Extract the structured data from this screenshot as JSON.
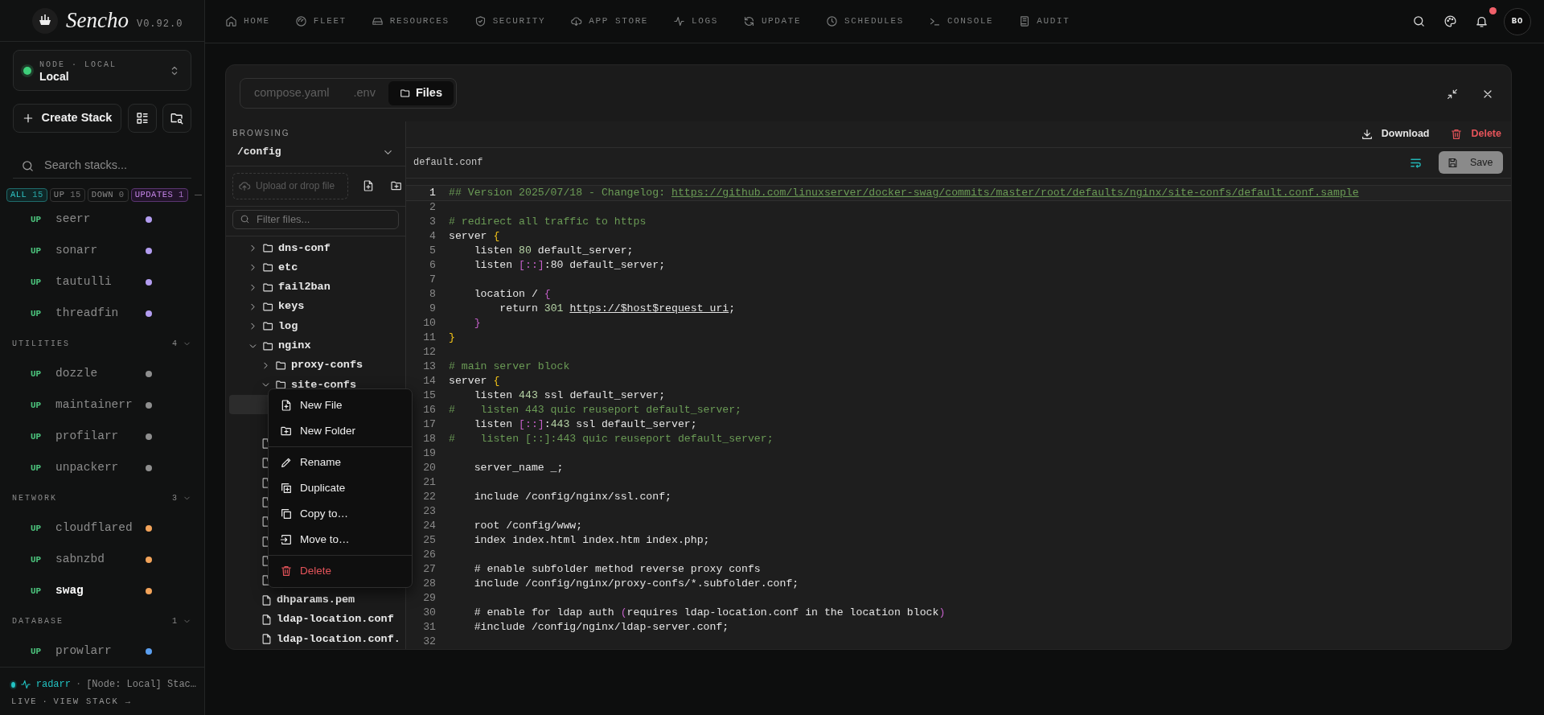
{
  "app": {
    "name": "Sencho",
    "version": "V0.92.0"
  },
  "node_selector": {
    "label": "NODE · LOCAL",
    "value": "Local"
  },
  "create_button": "Create Stack",
  "search": {
    "placeholder": "Search stacks..."
  },
  "filters": [
    {
      "label": "ALL",
      "count": "15",
      "selected": true,
      "kind": "status"
    },
    {
      "label": "UP",
      "count": "15",
      "selected": false,
      "kind": "status"
    },
    {
      "label": "DOWN",
      "count": "0",
      "selected": false,
      "kind": "status"
    },
    {
      "label": "UPDATES",
      "count": "1",
      "selected": false,
      "kind": "updates"
    }
  ],
  "stack_groups": [
    {
      "items": [
        {
          "status": "UP",
          "name": "seerr",
          "color": "#b39df0",
          "selected": false
        },
        {
          "status": "UP",
          "name": "sonarr",
          "color": "#b39df0",
          "selected": false
        },
        {
          "status": "UP",
          "name": "tautulli",
          "color": "#b39df0",
          "selected": false
        },
        {
          "status": "UP",
          "name": "threadfin",
          "color": "#b39df0",
          "selected": false
        }
      ]
    },
    {
      "title": "UTILITIES",
      "count": "4",
      "expanded": true,
      "items": [
        {
          "status": "UP",
          "name": "dozzle",
          "color": "#8e8e8e",
          "selected": false
        },
        {
          "status": "UP",
          "name": "maintainerr",
          "color": "#8e8e8e",
          "selected": false
        },
        {
          "status": "UP",
          "name": "profilarr",
          "color": "#8e8e8e",
          "selected": false
        },
        {
          "status": "UP",
          "name": "unpackerr",
          "color": "#8e8e8e",
          "selected": false
        }
      ]
    },
    {
      "title": "NETWORK",
      "count": "3",
      "expanded": true,
      "items": [
        {
          "status": "UP",
          "name": "cloudflared",
          "color": "#f2a35a",
          "selected": false
        },
        {
          "status": "UP",
          "name": "sabnzbd",
          "color": "#f2a35a",
          "selected": false
        },
        {
          "status": "UP",
          "name": "swag",
          "color": "#f2a35a",
          "selected": true
        }
      ]
    },
    {
      "title": "DATABASE",
      "count": "1",
      "expanded": true,
      "items": [
        {
          "status": "UP",
          "name": "prowlarr",
          "color": "#5b9ff0",
          "selected": false
        }
      ]
    }
  ],
  "activity": {
    "stack": "radarr",
    "separator": "·",
    "message": "[Node: Local] Stac…",
    "live": "LIVE",
    "dot": "·",
    "link": "VIEW STACK →"
  },
  "nav": [
    {
      "label": "HOME"
    },
    {
      "label": "FLEET"
    },
    {
      "label": "RESOURCES"
    },
    {
      "label": "SECURITY"
    },
    {
      "label": "APP STORE"
    },
    {
      "label": "LOGS"
    },
    {
      "label": "UPDATE"
    },
    {
      "label": "SCHEDULES"
    },
    {
      "label": "CONSOLE"
    },
    {
      "label": "AUDIT"
    }
  ],
  "user": {
    "initials": "BO",
    "unread": true
  },
  "editor_tabs": [
    {
      "label": "compose.yaml",
      "selected": false
    },
    {
      "label": ".env",
      "selected": false
    },
    {
      "label": "Files",
      "selected": true
    }
  ],
  "browser": {
    "label": "BROWSING",
    "path": "/config",
    "upload": "Upload or drop file",
    "filter_placeholder": "Filter files...",
    "tree": [
      {
        "kind": "folder",
        "name": "dns-conf",
        "expanded": false,
        "selected": false
      },
      {
        "kind": "folder",
        "name": "etc",
        "expanded": false,
        "selected": false
      },
      {
        "kind": "folder",
        "name": "fail2ban",
        "expanded": false,
        "selected": false
      },
      {
        "kind": "folder",
        "name": "keys",
        "expanded": false,
        "selected": false
      },
      {
        "kind": "folder",
        "name": "log",
        "expanded": false,
        "selected": false
      },
      {
        "kind": "folder",
        "name": "nginx",
        "expanded": true,
        "selected": false,
        "children": [
          {
            "kind": "folder",
            "name": "proxy-confs",
            "expanded": false,
            "selected": false
          },
          {
            "kind": "folder",
            "name": "site-confs",
            "expanded": true,
            "selected": false,
            "children": [
              {
                "selected": true
              },
              {
                "selected": false
              }
            ]
          },
          {
            "kind": "file",
            "selected": false
          },
          {
            "kind": "file",
            "selected": false
          },
          {
            "kind": "file",
            "selected": false
          },
          {
            "kind": "file",
            "selected": false
          },
          {
            "kind": "file",
            "selected": false
          },
          {
            "kind": "file",
            "selected": false
          },
          {
            "kind": "file",
            "selected": false
          },
          {
            "kind": "file",
            "selected": false
          },
          {
            "kind": "file",
            "name": "dhparams.pem",
            "selected": false
          },
          {
            "kind": "file",
            "name": "ldap-location.conf",
            "selected": false
          },
          {
            "kind": "file",
            "name": "ldap-location.conf.",
            "selected": false
          }
        ]
      }
    ]
  },
  "context_menu": [
    {
      "label": "New File",
      "kind": "new-file"
    },
    {
      "label": "New Folder",
      "kind": "new-folder"
    },
    {
      "kind": "divider"
    },
    {
      "label": "Rename",
      "kind": "rename"
    },
    {
      "label": "Duplicate",
      "kind": "duplicate"
    },
    {
      "label": "Copy to…",
      "kind": "copy"
    },
    {
      "label": "Move to…",
      "kind": "move"
    },
    {
      "kind": "divider"
    },
    {
      "label": "Delete",
      "kind": "delete"
    }
  ],
  "file_actions": [
    {
      "label": "Download",
      "kind": "download"
    },
    {
      "label": "Delete",
      "kind": "delete"
    }
  ],
  "file_name": "default.conf",
  "word_wrap": true,
  "save": {
    "label": "Save",
    "disabled": true
  },
  "code_lines": [
    {
      "number": "1",
      "selected": true,
      "tokens": [
        {
          "text": "## Version 2025/07/18 - Changelog: ",
          "kind": "comment"
        },
        {
          "text": "https://github.com/linuxserver/docker-swag/commits/master/root/defaults/nginx/site-confs/default.conf.sample",
          "kind": "comment-link"
        }
      ]
    },
    {
      "number": "2",
      "selected": false
    },
    {
      "number": "3",
      "selected": false,
      "tokens": [
        {
          "text": "# redirect all traffic to https",
          "kind": "comment"
        }
      ]
    },
    {
      "number": "4",
      "selected": false,
      "tokens": [
        {
          "text": "server ",
          "kind": "plain"
        },
        {
          "text": "{",
          "kind": "brace"
        }
      ]
    },
    {
      "number": "5",
      "selected": false,
      "tokens": [
        {
          "text": "    listen ",
          "kind": "plain"
        },
        {
          "text": "80",
          "kind": "number"
        },
        {
          "text": " default_server;",
          "kind": "plain"
        }
      ]
    },
    {
      "number": "6",
      "selected": false,
      "tokens": [
        {
          "text": "    listen ",
          "kind": "plain"
        },
        {
          "text": "[::]",
          "kind": "punct"
        },
        {
          "text": ":80 default_server;",
          "kind": "plain"
        }
      ]
    },
    {
      "number": "7",
      "selected": false
    },
    {
      "number": "8",
      "selected": false,
      "tokens": [
        {
          "text": "    location / ",
          "kind": "plain"
        },
        {
          "text": "{",
          "kind": "punct"
        }
      ]
    },
    {
      "number": "9",
      "selected": false,
      "tokens": [
        {
          "text": "        return ",
          "kind": "plain"
        },
        {
          "text": "301 ",
          "kind": "number"
        },
        {
          "text": "https://$host$request_uri",
          "kind": "link"
        },
        {
          "text": ";",
          "kind": "plain"
        }
      ]
    },
    {
      "number": "10",
      "selected": false,
      "tokens": [
        {
          "text": "    }",
          "kind": "punct"
        }
      ]
    },
    {
      "number": "11",
      "selected": false,
      "tokens": [
        {
          "text": "}",
          "kind": "brace"
        }
      ]
    },
    {
      "number": "12",
      "selected": false
    },
    {
      "number": "13",
      "selected": false,
      "tokens": [
        {
          "text": "# main server block",
          "kind": "comment"
        }
      ]
    },
    {
      "number": "14",
      "selected": false,
      "tokens": [
        {
          "text": "server ",
          "kind": "plain"
        },
        {
          "text": "{",
          "kind": "brace"
        }
      ]
    },
    {
      "number": "15",
      "selected": false,
      "tokens": [
        {
          "text": "    listen ",
          "kind": "plain"
        },
        {
          "text": "443",
          "kind": "number"
        },
        {
          "text": " ssl default_server;",
          "kind": "plain"
        }
      ]
    },
    {
      "number": "16",
      "selected": false,
      "tokens": [
        {
          "text": "#    listen 443 quic reuseport default_server;",
          "kind": "comment"
        }
      ]
    },
    {
      "number": "17",
      "selected": false,
      "tokens": [
        {
          "text": "    listen ",
          "kind": "plain"
        },
        {
          "text": "[::]",
          "kind": "punct"
        },
        {
          "text": ":",
          "kind": "plain"
        },
        {
          "text": "443",
          "kind": "number"
        },
        {
          "text": " ssl default_server;",
          "kind": "plain"
        }
      ]
    },
    {
      "number": "18",
      "selected": false,
      "tokens": [
        {
          "text": "#    listen [::]:443 quic reuseport default_server;",
          "kind": "comment"
        }
      ]
    },
    {
      "number": "19",
      "selected": false
    },
    {
      "number": "20",
      "selected": false,
      "tokens": [
        {
          "text": "    server_name _;",
          "kind": "plain"
        }
      ]
    },
    {
      "number": "21",
      "selected": false
    },
    {
      "number": "22",
      "selected": false,
      "tokens": [
        {
          "text": "    include /config/nginx/ssl.conf;",
          "kind": "plain"
        }
      ]
    },
    {
      "number": "23",
      "selected": false
    },
    {
      "number": "24",
      "selected": false,
      "tokens": [
        {
          "text": "    root /config/www;",
          "kind": "plain"
        }
      ]
    },
    {
      "number": "25",
      "selected": false,
      "tokens": [
        {
          "text": "    index index.html index.htm index.php;",
          "kind": "plain"
        }
      ]
    },
    {
      "number": "26",
      "selected": false
    },
    {
      "number": "27",
      "selected": false,
      "tokens": [
        {
          "text": "    # enable subfolder method reverse proxy confs",
          "kind": "plain"
        }
      ]
    },
    {
      "number": "28",
      "selected": false,
      "tokens": [
        {
          "text": "    include /config/nginx/proxy-confs/*.subfolder.conf;",
          "kind": "plain"
        }
      ]
    },
    {
      "number": "29",
      "selected": false
    },
    {
      "number": "30",
      "selected": false,
      "tokens": [
        {
          "text": "    # enable for ldap auth ",
          "kind": "plain"
        },
        {
          "text": "(",
          "kind": "punct"
        },
        {
          "text": "requires ldap-location.conf in the location block",
          "kind": "plain"
        },
        {
          "text": ")",
          "kind": "punct"
        }
      ]
    },
    {
      "number": "31",
      "selected": false,
      "tokens": [
        {
          "text": "    #include /config/nginx/ldap-server.conf;",
          "kind": "plain"
        }
      ]
    },
    {
      "number": "32",
      "selected": false
    }
  ]
}
